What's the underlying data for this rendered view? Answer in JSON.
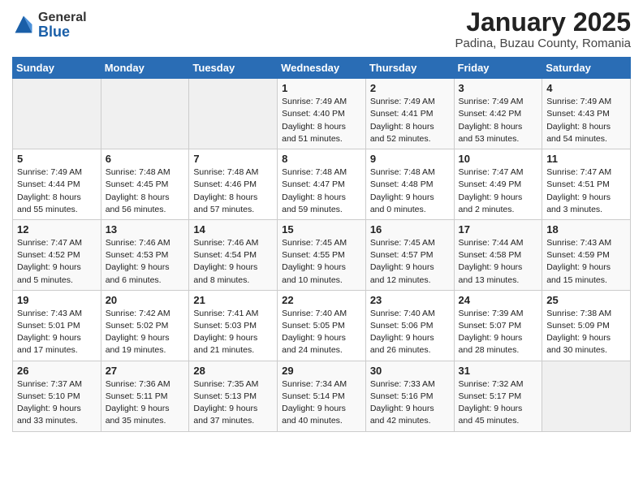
{
  "logo": {
    "general": "General",
    "blue": "Blue"
  },
  "title": "January 2025",
  "subtitle": "Padina, Buzau County, Romania",
  "headers": [
    "Sunday",
    "Monday",
    "Tuesday",
    "Wednesday",
    "Thursday",
    "Friday",
    "Saturday"
  ],
  "weeks": [
    [
      {
        "num": "",
        "info": ""
      },
      {
        "num": "",
        "info": ""
      },
      {
        "num": "",
        "info": ""
      },
      {
        "num": "1",
        "info": "Sunrise: 7:49 AM\nSunset: 4:40 PM\nDaylight: 8 hours and 51 minutes."
      },
      {
        "num": "2",
        "info": "Sunrise: 7:49 AM\nSunset: 4:41 PM\nDaylight: 8 hours and 52 minutes."
      },
      {
        "num": "3",
        "info": "Sunrise: 7:49 AM\nSunset: 4:42 PM\nDaylight: 8 hours and 53 minutes."
      },
      {
        "num": "4",
        "info": "Sunrise: 7:49 AM\nSunset: 4:43 PM\nDaylight: 8 hours and 54 minutes."
      }
    ],
    [
      {
        "num": "5",
        "info": "Sunrise: 7:49 AM\nSunset: 4:44 PM\nDaylight: 8 hours and 55 minutes."
      },
      {
        "num": "6",
        "info": "Sunrise: 7:48 AM\nSunset: 4:45 PM\nDaylight: 8 hours and 56 minutes."
      },
      {
        "num": "7",
        "info": "Sunrise: 7:48 AM\nSunset: 4:46 PM\nDaylight: 8 hours and 57 minutes."
      },
      {
        "num": "8",
        "info": "Sunrise: 7:48 AM\nSunset: 4:47 PM\nDaylight: 8 hours and 59 minutes."
      },
      {
        "num": "9",
        "info": "Sunrise: 7:48 AM\nSunset: 4:48 PM\nDaylight: 9 hours and 0 minutes."
      },
      {
        "num": "10",
        "info": "Sunrise: 7:47 AM\nSunset: 4:49 PM\nDaylight: 9 hours and 2 minutes."
      },
      {
        "num": "11",
        "info": "Sunrise: 7:47 AM\nSunset: 4:51 PM\nDaylight: 9 hours and 3 minutes."
      }
    ],
    [
      {
        "num": "12",
        "info": "Sunrise: 7:47 AM\nSunset: 4:52 PM\nDaylight: 9 hours and 5 minutes."
      },
      {
        "num": "13",
        "info": "Sunrise: 7:46 AM\nSunset: 4:53 PM\nDaylight: 9 hours and 6 minutes."
      },
      {
        "num": "14",
        "info": "Sunrise: 7:46 AM\nSunset: 4:54 PM\nDaylight: 9 hours and 8 minutes."
      },
      {
        "num": "15",
        "info": "Sunrise: 7:45 AM\nSunset: 4:55 PM\nDaylight: 9 hours and 10 minutes."
      },
      {
        "num": "16",
        "info": "Sunrise: 7:45 AM\nSunset: 4:57 PM\nDaylight: 9 hours and 12 minutes."
      },
      {
        "num": "17",
        "info": "Sunrise: 7:44 AM\nSunset: 4:58 PM\nDaylight: 9 hours and 13 minutes."
      },
      {
        "num": "18",
        "info": "Sunrise: 7:43 AM\nSunset: 4:59 PM\nDaylight: 9 hours and 15 minutes."
      }
    ],
    [
      {
        "num": "19",
        "info": "Sunrise: 7:43 AM\nSunset: 5:01 PM\nDaylight: 9 hours and 17 minutes."
      },
      {
        "num": "20",
        "info": "Sunrise: 7:42 AM\nSunset: 5:02 PM\nDaylight: 9 hours and 19 minutes."
      },
      {
        "num": "21",
        "info": "Sunrise: 7:41 AM\nSunset: 5:03 PM\nDaylight: 9 hours and 21 minutes."
      },
      {
        "num": "22",
        "info": "Sunrise: 7:40 AM\nSunset: 5:05 PM\nDaylight: 9 hours and 24 minutes."
      },
      {
        "num": "23",
        "info": "Sunrise: 7:40 AM\nSunset: 5:06 PM\nDaylight: 9 hours and 26 minutes."
      },
      {
        "num": "24",
        "info": "Sunrise: 7:39 AM\nSunset: 5:07 PM\nDaylight: 9 hours and 28 minutes."
      },
      {
        "num": "25",
        "info": "Sunrise: 7:38 AM\nSunset: 5:09 PM\nDaylight: 9 hours and 30 minutes."
      }
    ],
    [
      {
        "num": "26",
        "info": "Sunrise: 7:37 AM\nSunset: 5:10 PM\nDaylight: 9 hours and 33 minutes."
      },
      {
        "num": "27",
        "info": "Sunrise: 7:36 AM\nSunset: 5:11 PM\nDaylight: 9 hours and 35 minutes."
      },
      {
        "num": "28",
        "info": "Sunrise: 7:35 AM\nSunset: 5:13 PM\nDaylight: 9 hours and 37 minutes."
      },
      {
        "num": "29",
        "info": "Sunrise: 7:34 AM\nSunset: 5:14 PM\nDaylight: 9 hours and 40 minutes."
      },
      {
        "num": "30",
        "info": "Sunrise: 7:33 AM\nSunset: 5:16 PM\nDaylight: 9 hours and 42 minutes."
      },
      {
        "num": "31",
        "info": "Sunrise: 7:32 AM\nSunset: 5:17 PM\nDaylight: 9 hours and 45 minutes."
      },
      {
        "num": "",
        "info": ""
      }
    ]
  ]
}
